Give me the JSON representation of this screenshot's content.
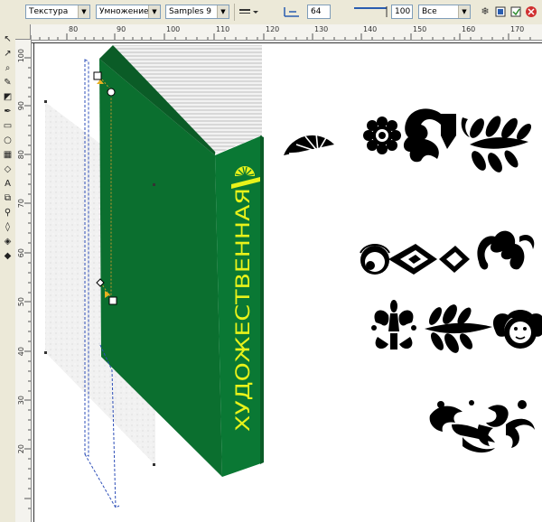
{
  "propbar": {
    "fill_type": "Текстура",
    "blend_mode": "Умножение",
    "sample": "Samples 9",
    "transparency_value": "64",
    "percent_value": "100",
    "target": "Все"
  },
  "ruler": {
    "h_labels": [
      "80",
      "90",
      "100",
      "110",
      "120",
      "130",
      "140",
      "150",
      "160",
      "170"
    ],
    "v_labels": [
      "100",
      "90",
      "80",
      "70",
      "60",
      "50",
      "40",
      "30",
      "20"
    ]
  },
  "book": {
    "spine_title": "ХУДОЖЕСТВЕННАЯ",
    "cover_color": "#0e7a36",
    "spine_text_color": "#e8f21a"
  },
  "tools": [
    "pick-tool-icon",
    "shape-tool-icon",
    "crop-tool-icon",
    "zoom-tool-icon",
    "freehand-tool-icon",
    "smart-fill-icon",
    "rectangle-tool-icon",
    "ellipse-tool-icon",
    "polygon-tool-icon",
    "spiral-tool-icon",
    "text-tool-icon",
    "interactive-blend-icon",
    "eyedropper-icon",
    "outline-tool-icon",
    "fill-tool-icon",
    "interactive-fill-icon"
  ]
}
